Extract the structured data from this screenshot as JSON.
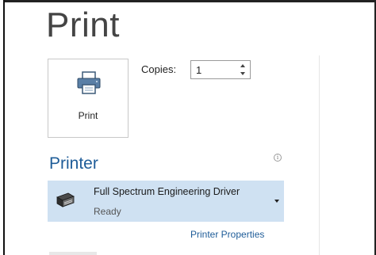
{
  "header": {
    "title": "Print"
  },
  "print_button": {
    "label": "Print",
    "icon": "printer-icon"
  },
  "copies": {
    "label": "Copies:",
    "value": "1"
  },
  "printer_section": {
    "heading": "Printer",
    "info_icon": "info-icon",
    "selected_printer": {
      "name": "Full Spectrum Engineering Driver",
      "status": "Ready",
      "icon": "laser-printer-icon"
    },
    "properties_link": "Printer Properties"
  },
  "colors": {
    "accent": "#1e5c98",
    "selection_background": "#cfe1f2",
    "title_text": "#444444"
  }
}
